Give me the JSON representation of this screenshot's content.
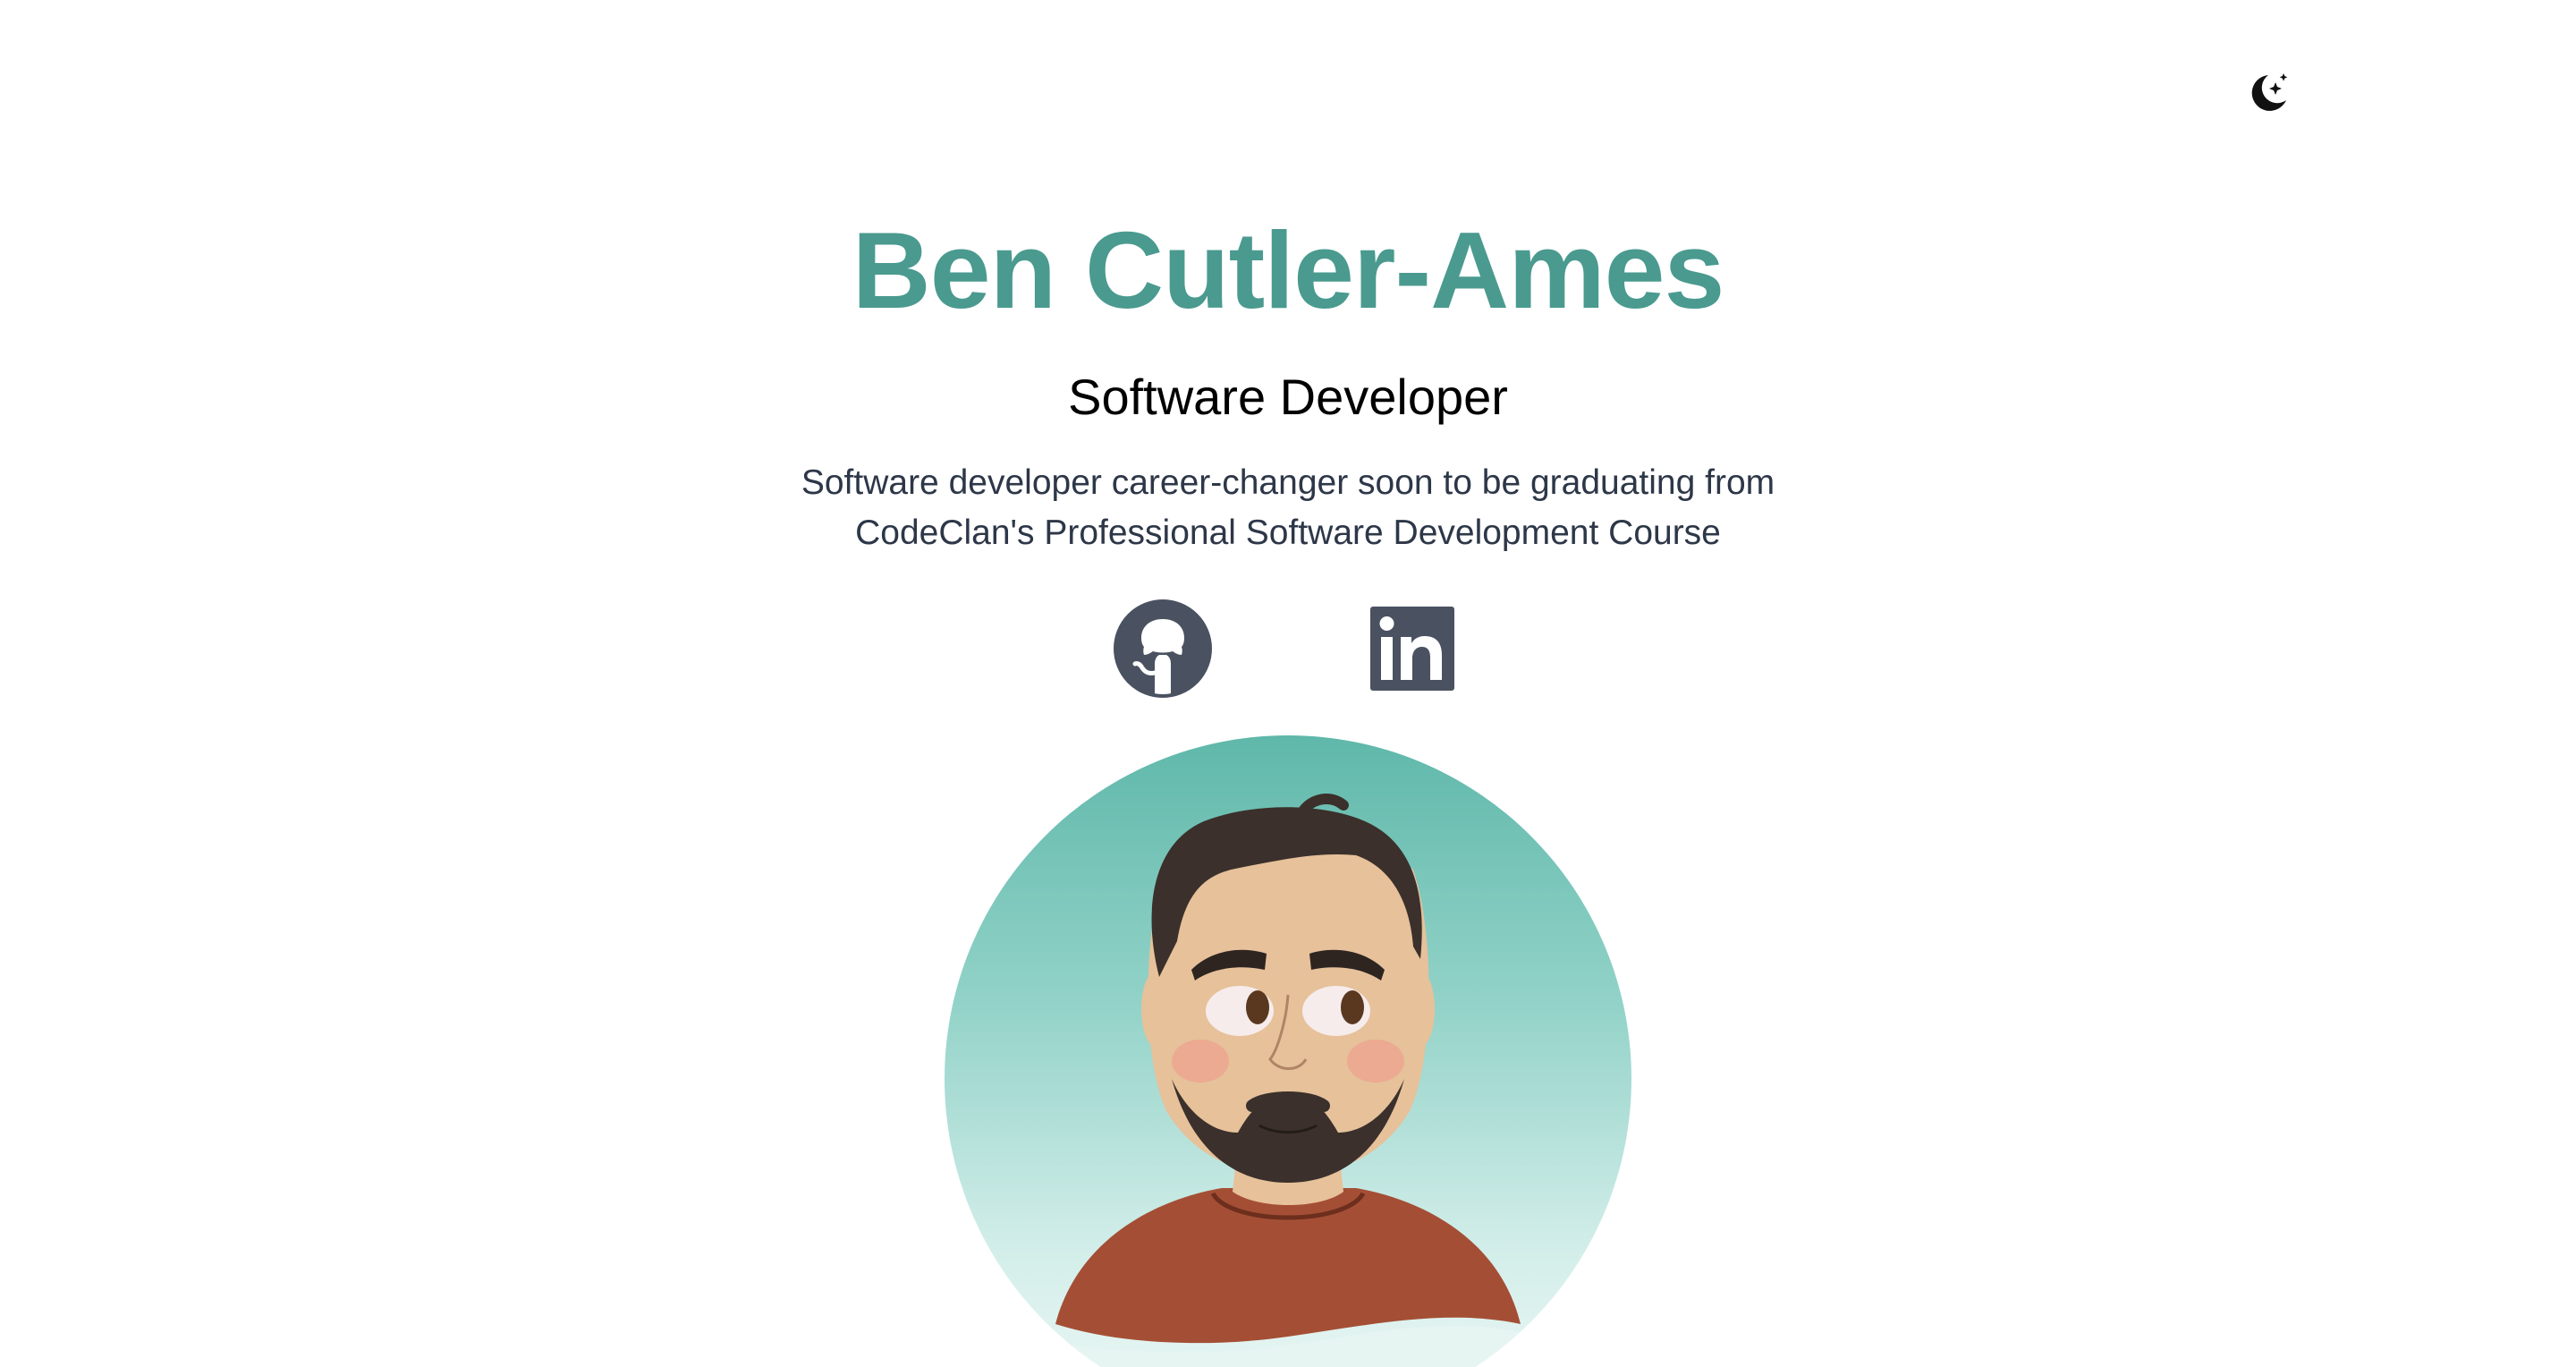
{
  "header": {
    "theme_toggle_icon": "moon-stars-icon"
  },
  "hero": {
    "name": "Ben Cutler-Ames",
    "role": "Software Developer",
    "bio_line1": "Software developer career-changer soon to be graduating from",
    "bio_line2": "CodeClan's Professional Software Development Course"
  },
  "social": [
    {
      "name": "GitHub",
      "icon": "github-icon"
    },
    {
      "name": "LinkedIn",
      "icon": "linkedin-icon"
    }
  ],
  "avatar": {
    "icon": "avatar-illustration"
  },
  "colors": {
    "accent": "#4a9a8f",
    "text": "#000000",
    "body_text": "#2d3748",
    "icon_gray": "#4a5261",
    "avatar_bg_top": "#5fb8aa",
    "avatar_bg_bottom": "#eef8f6"
  }
}
